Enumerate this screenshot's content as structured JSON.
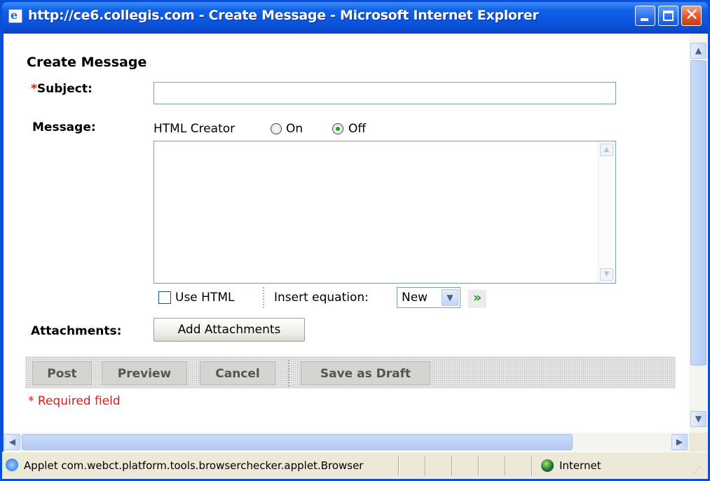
{
  "window": {
    "title": "http://ce6.collegis.com - Create Message - Microsoft Internet Explorer",
    "buttons": {
      "minimize": "min",
      "maximize": "max",
      "close": "✕"
    }
  },
  "form": {
    "page_title": "Create Message",
    "subject": {
      "required_mark": "*",
      "label": "Subject:",
      "value": ""
    },
    "message": {
      "label": "Message:",
      "html_creator_label": "HTML Creator",
      "html_creator_options": [
        "On",
        "Off"
      ],
      "html_creator_selected": "Off",
      "body": "",
      "use_html_label": "Use HTML",
      "use_html_checked": false,
      "insert_equation_label": "Insert equation:",
      "insert_equation_value": "New"
    },
    "attachments": {
      "label": "Attachments:",
      "button": "Add Attachments"
    },
    "actions": {
      "post": "Post",
      "preview": "Preview",
      "cancel": "Cancel",
      "save_draft": "Save as Draft"
    },
    "required_note": "* Required field"
  },
  "statusbar": {
    "text": "Applet com.webct.platform.tools.browserchecker.applet.Browser",
    "zone": "Internet"
  },
  "icons": {
    "page": "ie-page-icon",
    "go": "green-arrow-icon",
    "zone": "internet-zone-icon"
  },
  "colors": {
    "title_bar": "#0a54de",
    "required": "#e01b1b",
    "go_arrow": "#2a9d1d"
  }
}
